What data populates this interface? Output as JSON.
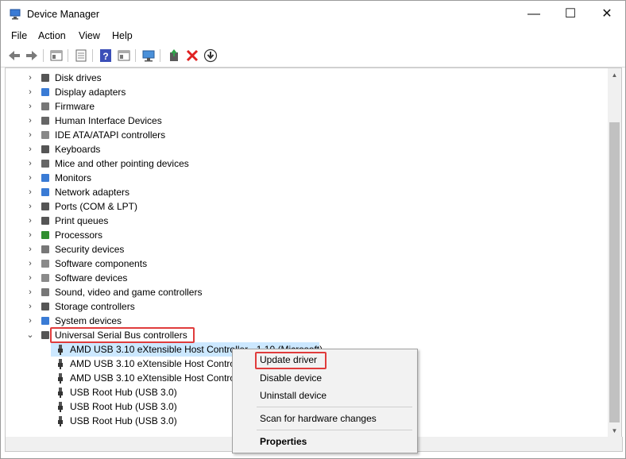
{
  "window": {
    "title": "Device Manager",
    "minimize": "—",
    "maximize": "☐",
    "close": "✕"
  },
  "menu": [
    "File",
    "Action",
    "View",
    "Help"
  ],
  "toolbar_icons": [
    "back-icon",
    "forward-icon",
    "properties-icon",
    "list-icon",
    "help-icon",
    "view-icon",
    "monitor-icon",
    "update-driver-icon",
    "uninstall-icon",
    "download-icon"
  ],
  "tree": [
    {
      "label": "Disk drives",
      "icon": "disk-icon",
      "expander": "›"
    },
    {
      "label": "Display adapters",
      "icon": "display-icon",
      "expander": "›"
    },
    {
      "label": "Firmware",
      "icon": "firmware-icon",
      "expander": "›"
    },
    {
      "label": "Human Interface Devices",
      "icon": "hid-icon",
      "expander": "›"
    },
    {
      "label": "IDE ATA/ATAPI controllers",
      "icon": "ide-icon",
      "expander": "›"
    },
    {
      "label": "Keyboards",
      "icon": "keyboard-icon",
      "expander": "›"
    },
    {
      "label": "Mice and other pointing devices",
      "icon": "mouse-icon",
      "expander": "›"
    },
    {
      "label": "Monitors",
      "icon": "monitor-icon",
      "expander": "›"
    },
    {
      "label": "Network adapters",
      "icon": "network-icon",
      "expander": "›"
    },
    {
      "label": "Ports (COM & LPT)",
      "icon": "port-icon",
      "expander": "›"
    },
    {
      "label": "Print queues",
      "icon": "printer-icon",
      "expander": "›"
    },
    {
      "label": "Processors",
      "icon": "processor-icon",
      "expander": "›"
    },
    {
      "label": "Security devices",
      "icon": "security-icon",
      "expander": "›"
    },
    {
      "label": "Software components",
      "icon": "software-component-icon",
      "expander": "›"
    },
    {
      "label": "Software devices",
      "icon": "software-device-icon",
      "expander": "›"
    },
    {
      "label": "Sound, video and game controllers",
      "icon": "sound-icon",
      "expander": "›"
    },
    {
      "label": "Storage controllers",
      "icon": "storage-icon",
      "expander": "›"
    },
    {
      "label": "System devices",
      "icon": "system-icon",
      "expander": "›"
    },
    {
      "label": "Universal Serial Bus controllers",
      "icon": "usb-icon",
      "expander": "⌄"
    }
  ],
  "usb_children": [
    "AMD USB 3.10 eXtensible Host Controller - 1.10 (Microsoft)",
    "AMD USB 3.10 eXtensible Host Controller - 1.10 (Microsoft)",
    "AMD USB 3.10 eXtensible Host Controller - 1.10 (Microsoft)",
    "USB Root Hub (USB 3.0)",
    "USB Root Hub (USB 3.0)",
    "USB Root Hub (USB 3.0)"
  ],
  "context_menu": {
    "update": "Update driver",
    "disable": "Disable device",
    "uninstall": "Uninstall device",
    "scan": "Scan for hardware changes",
    "properties": "Properties"
  },
  "colors": {
    "highlight": "#e03c3c",
    "selection": "#cce8ff"
  }
}
